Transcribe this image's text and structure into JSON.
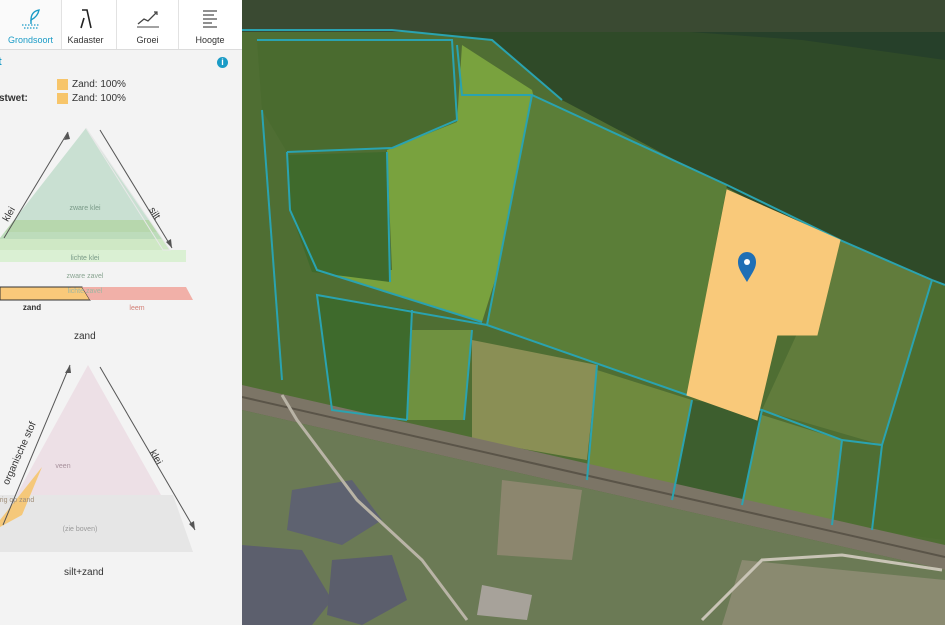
{
  "tabs": [
    {
      "label": "Grondsoort",
      "icon": "soil-icon",
      "active": true
    },
    {
      "label": "Kadaster",
      "icon": "cadastre-icon",
      "active": false
    },
    {
      "label": "Groei",
      "icon": "growth-chart-icon",
      "active": false
    },
    {
      "label": "Hoogte",
      "icon": "height-lines-icon",
      "active": false
    }
  ],
  "info": {
    "title": "t",
    "row1_value": "Zand: 100%",
    "row2_label": "stwet:",
    "row2_value": "Zand: 100%",
    "info_icon": "i"
  },
  "triangle1": {
    "left_axis": "klei",
    "right_axis": "silt",
    "bottom_label": "zand",
    "zones": [
      "zware klei",
      "lichte klei",
      "zavel",
      "zware zavel",
      "lichte zavel",
      "zand",
      "leem"
    ],
    "highlight": "zand"
  },
  "triangle2": {
    "left_axis": "organische stof",
    "right_axis": "klei",
    "bottom_label": "silt+zand",
    "zones": [
      "veen",
      "moerig op zand",
      "(zie boven)"
    ]
  },
  "map": {
    "selected_parcel_color": "#f9c97a",
    "parcel_border_color": "#2aa3b0",
    "marker_color": "#1f6fb5"
  }
}
